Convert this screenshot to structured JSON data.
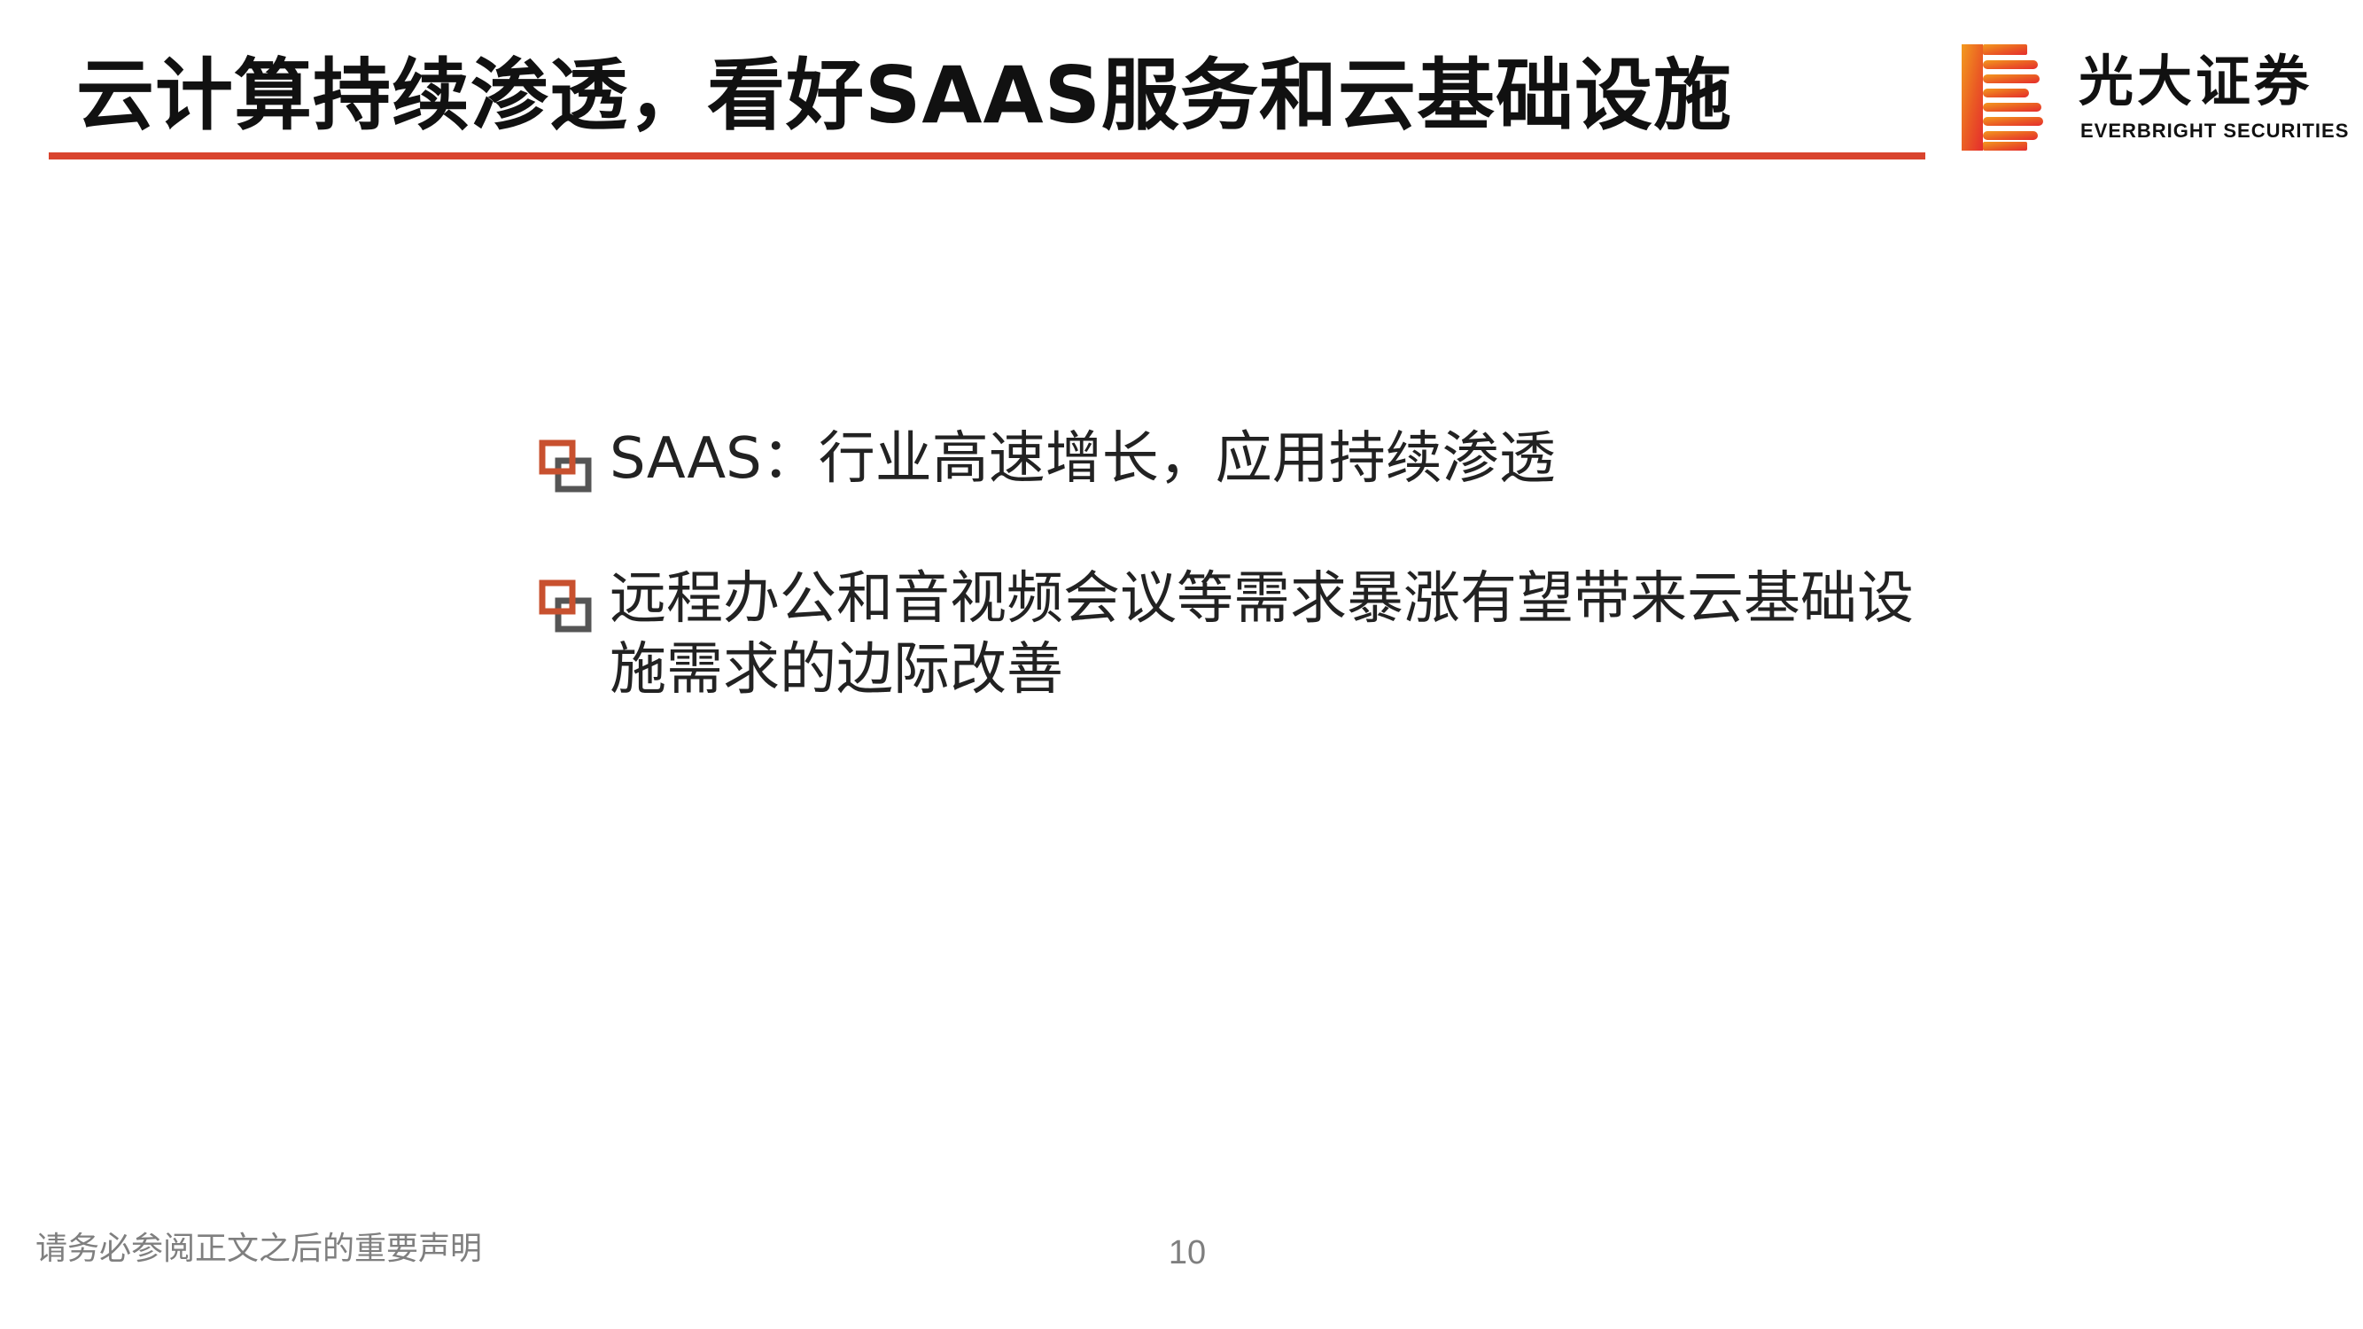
{
  "slide": {
    "title": "云计算持续渗透，看好SAAS服务和云基础设施",
    "page_number": "10",
    "footer_disclaimer": "请务必参阅正文之后的重要声明"
  },
  "logo": {
    "name_cn": "光大证券",
    "name_en": "EVERBRIGHT SECURITIES",
    "mark_icon": "everbright-b-logo-icon"
  },
  "bullets": [
    {
      "text": "SAAS：行业高速增长，应用持续渗透",
      "icon": "double-square-bullet-icon"
    },
    {
      "text": "远程办公和音视频会议等需求暴涨有望带来云基础设施需求的边际改善",
      "icon": "double-square-bullet-icon"
    }
  ],
  "colors": {
    "accent_red": "#d9442e",
    "bullet_orange": "#c8512f",
    "bullet_gray": "#555555",
    "logo_red": "#e52d2d",
    "logo_orange": "#f39a1e"
  }
}
